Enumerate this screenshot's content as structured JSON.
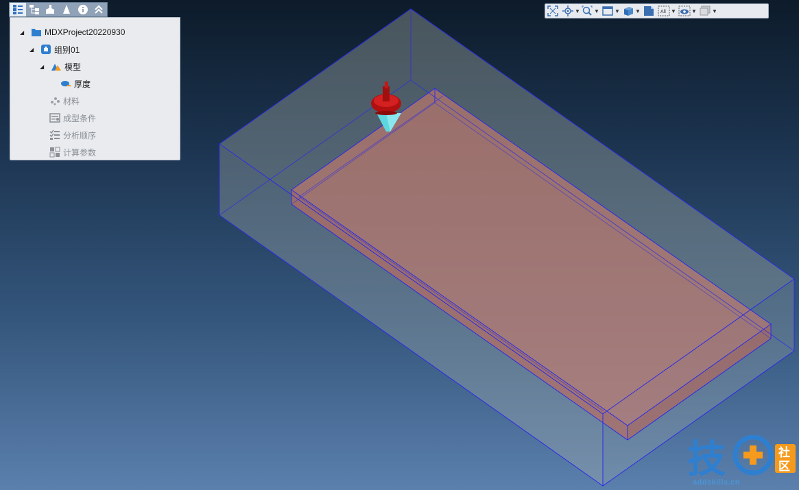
{
  "tree": {
    "tabs": [
      {
        "icon": "tree-view-icon"
      },
      {
        "icon": "hierarchy-icon"
      },
      {
        "icon": "mold-icon"
      },
      {
        "icon": "cone-icon"
      },
      {
        "icon": "info-icon"
      },
      {
        "icon": "collapse-up-icon"
      }
    ],
    "items": [
      {
        "label": "MDXProject20220930",
        "icon": "folder-icon",
        "expanded": true,
        "disabled": false
      },
      {
        "label": "组别01",
        "icon": "group-icon",
        "expanded": true,
        "disabled": false
      },
      {
        "label": "模型",
        "icon": "model-icon",
        "expanded": true,
        "disabled": false
      },
      {
        "label": "厚度",
        "icon": "thickness-icon",
        "expanded": false,
        "disabled": false
      },
      {
        "label": "材料",
        "icon": "material-icon",
        "expanded": false,
        "disabled": true
      },
      {
        "label": "成型条件",
        "icon": "molding-conditions-icon",
        "expanded": false,
        "disabled": true
      },
      {
        "label": "分析顺序",
        "icon": "analysis-sequence-icon",
        "expanded": false,
        "disabled": true
      },
      {
        "label": "计算参数",
        "icon": "calc-params-icon",
        "expanded": false,
        "disabled": true
      }
    ]
  },
  "toolbar": {
    "buttons": [
      {
        "icon": "fit-view-icon",
        "dropdown": false
      },
      {
        "icon": "rotate-center-icon",
        "dropdown": true
      },
      {
        "icon": "zoom-icon",
        "dropdown": true
      },
      {
        "icon": "window-view-icon",
        "dropdown": true
      },
      {
        "icon": "cube-view-icon",
        "dropdown": true
      },
      {
        "icon": "page-icon",
        "dropdown": false
      },
      {
        "icon": "select-all-icon",
        "label": "All",
        "dropdown": true
      },
      {
        "icon": "eye-visibility-icon",
        "dropdown": true
      },
      {
        "icon": "layers-icon",
        "dropdown": true
      }
    ]
  },
  "watermark": {
    "text": "addskills.cn",
    "logo_char": "技",
    "badge_chars": [
      "社",
      "区"
    ]
  },
  "colors": {
    "mold_edge": "#2a2ae8",
    "part_fill": "#c97a6c",
    "nozzle_red": "#b01010",
    "nozzle_cyan": "#5ed6e0",
    "accent": "#3b6fb0",
    "watermark_blue": "#2f7fd0",
    "watermark_orange": "#f59a1c"
  }
}
